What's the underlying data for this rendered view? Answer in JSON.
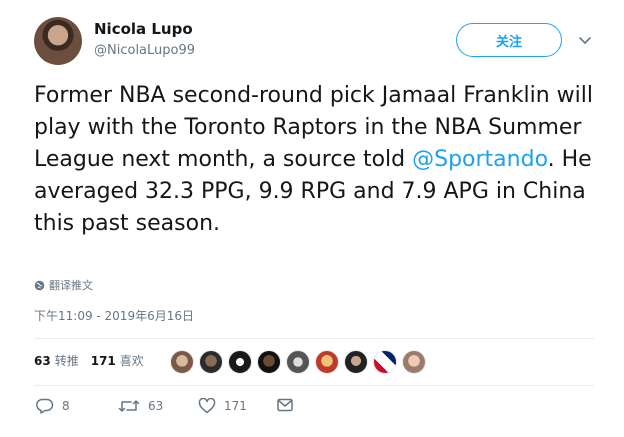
{
  "author": {
    "display_name": "Nicola Lupo",
    "handle": "@NicolaLupo99"
  },
  "follow_label": "关注",
  "tweet": {
    "text_before": "Former NBA second-round pick Jamaal Franklin will play with the Toronto Raptors in the NBA Summer League next month, a source told ",
    "mention": "@Sportando",
    "text_after": ". He averaged 32.3 PPG, 9.9 RPG and 7.9 APG in China this past season."
  },
  "translate_label": "翻译推文",
  "timestamp": "下午11:09 - 2019年6月16日",
  "stats": {
    "retweets_count": "63",
    "retweets_label": "转推",
    "likes_count": "171",
    "likes_label": "喜欢"
  },
  "actions": {
    "reply_count": "8",
    "retweet_count": "63",
    "like_count": "171"
  },
  "colors": {
    "accent": "#1da1f2",
    "muted": "#657786",
    "text": "#14171a",
    "divider": "#e6ecf0"
  },
  "icons": [
    "globe-icon",
    "chevron-down-icon",
    "reply-icon",
    "retweet-icon",
    "heart-icon",
    "envelope-icon"
  ]
}
